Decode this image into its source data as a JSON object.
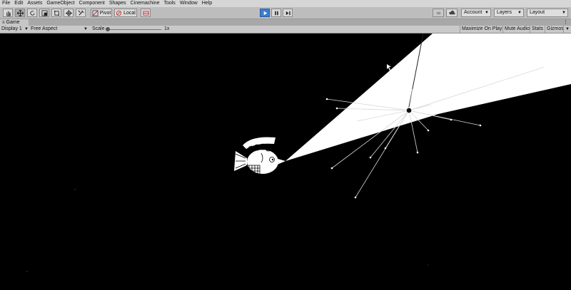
{
  "menu": [
    "File",
    "Edit",
    "Assets",
    "GameObject",
    "Component",
    "Shapes",
    "Cinemachine",
    "Tools",
    "Window",
    "Help"
  ],
  "toolbar": {
    "pivot_label": "Pivot",
    "local_label": "Local",
    "account_label": "Account",
    "layers_label": "Layers",
    "layout_label": "Layout"
  },
  "game": {
    "tab_label": "Game",
    "display": "Display 1",
    "aspect": "Free Aspect",
    "scale_label": "Scale",
    "scale_value": "1x",
    "maximize_label": "Maximize On Play",
    "mute_label": "Mute Audio",
    "stats_label": "Stats",
    "gizmos_label": "Gizmos"
  },
  "colors": {
    "accent": "#3b7ed1",
    "background": "#000000",
    "light_beam": "#ffffff"
  }
}
